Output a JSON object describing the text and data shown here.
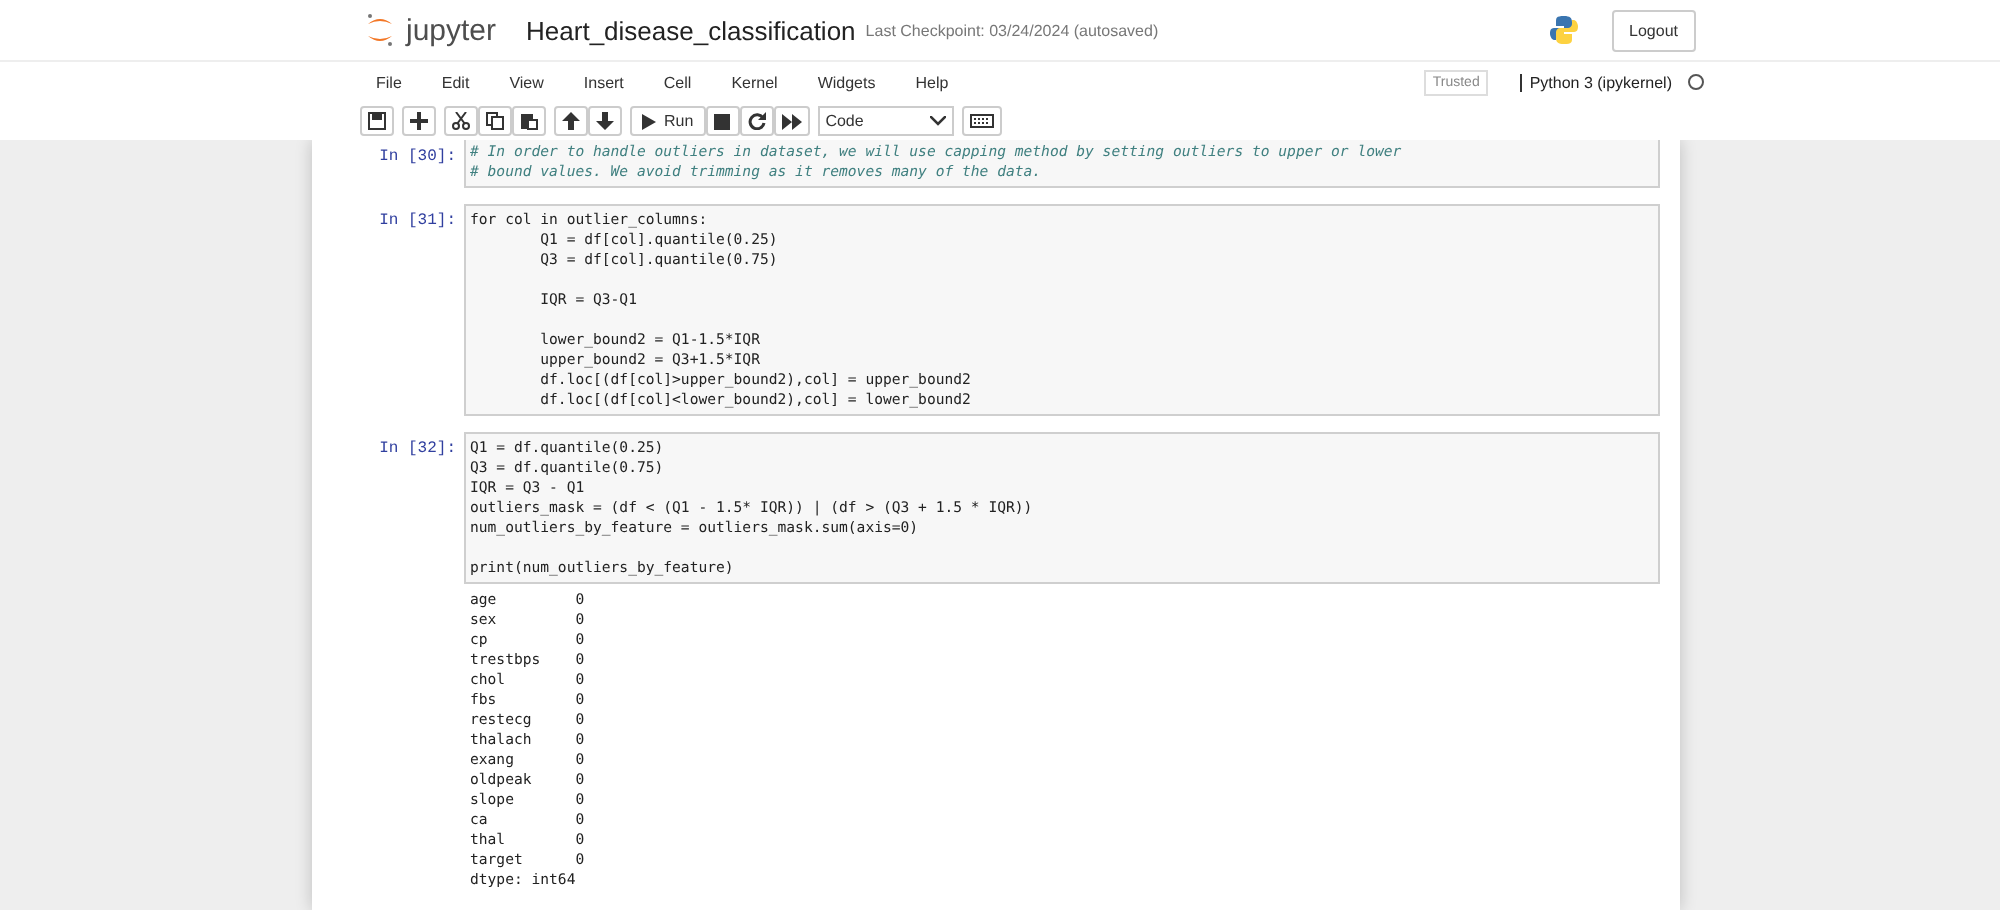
{
  "header": {
    "logo_text": "jupyter",
    "notebook_name": "Heart_disease_classification",
    "checkpoint": "Last Checkpoint: 03/24/2024 (autosaved)",
    "logout": "Logout"
  },
  "menu": [
    "File",
    "Edit",
    "View",
    "Insert",
    "Cell",
    "Kernel",
    "Widgets",
    "Help"
  ],
  "trusted": "Trusted",
  "kernel": "Python 3 (ipykernel)",
  "toolbar": {
    "run": "Run",
    "cell_type": "Code"
  },
  "cells": [
    {
      "prompt": "In [30]:",
      "kind": "comment",
      "blocks": [
        [
          "# In order to handle outliers in dataset, we will use capping method by setting outliers to upper or lower",
          "# bound values. We avoid trimming as it removes many of the data."
        ]
      ]
    },
    {
      "prompt": "In [31]:",
      "kind": "code",
      "blocks": [
        [
          "for col in outlier_columns:",
          "        Q1 = df[col].quantile(0.25)",
          "        Q3 = df[col].quantile(0.75)"
        ],
        [
          "        IQR = Q3-Q1"
        ],
        [
          "        lower_bound2 = Q1-1.5*IQR",
          "        upper_bound2 = Q3+1.5*IQR",
          "        df.loc[(df[col]>upper_bound2),col] = upper_bound2",
          "        df.loc[(df[col]<lower_bound2),col] = lower_bound2"
        ]
      ]
    },
    {
      "prompt": "In [32]:",
      "kind": "code",
      "blocks": [
        [
          "Q1 = df.quantile(0.25)",
          "Q3 = df.quantile(0.75)",
          "IQR = Q3 - Q1",
          "outliers_mask = (df < (Q1 - 1.5* IQR)) | (df > (Q3 + 1.5 * IQR))",
          "num_outliers_by_feature = outliers_mask.sum(axis=0)"
        ],
        [
          "print(num_outliers_by_feature)"
        ]
      ],
      "output": [
        "age         0",
        "sex         0",
        "cp          0",
        "trestbps    0",
        "chol        0",
        "fbs         0",
        "restecg     0",
        "thalach     0",
        "exang       0",
        "oldpeak     0",
        "slope       0",
        "ca          0",
        "thal        0",
        "target      0",
        "dtype: int64"
      ]
    }
  ]
}
